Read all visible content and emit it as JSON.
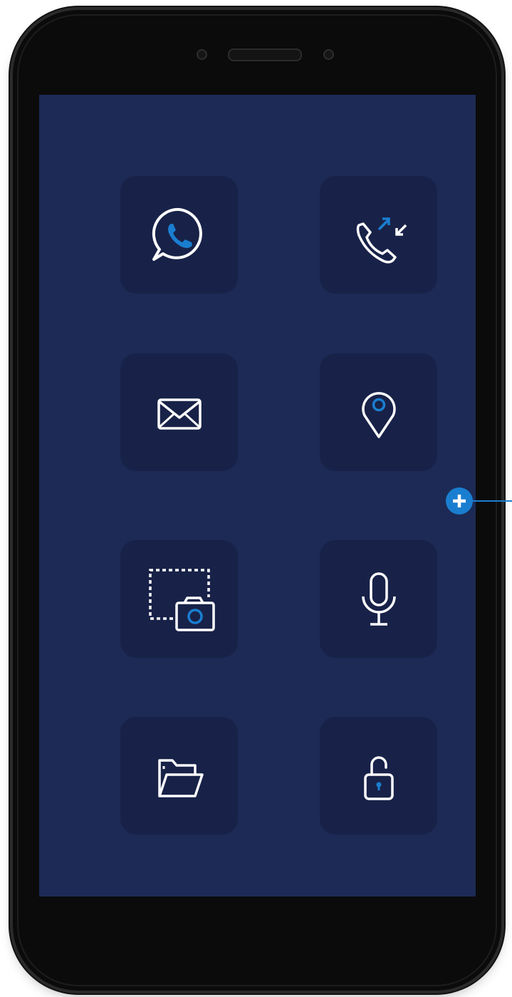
{
  "colors": {
    "screen_background": "#1c2a55",
    "tile_background": "#182248",
    "icon_stroke": "#ffffff",
    "accent": "#1a7ed0",
    "phone_body": "#0b0b0b"
  },
  "device": {
    "top_bezel": {
      "speaker": "earpiece-speaker",
      "sensors": [
        "front-camera-icon",
        "proximity-sensor-icon"
      ]
    }
  },
  "app_grid": {
    "tiles": [
      {
        "icon": "whatsapp-icon"
      },
      {
        "icon": "call-log-icon"
      },
      {
        "icon": "mail-icon"
      },
      {
        "icon": "location-pin-icon"
      },
      {
        "icon": "screenshot-camera-icon"
      },
      {
        "icon": "microphone-icon"
      },
      {
        "icon": "folder-icon"
      },
      {
        "icon": "unlock-icon"
      }
    ]
  },
  "add_control": {
    "icon": "plus-icon"
  }
}
